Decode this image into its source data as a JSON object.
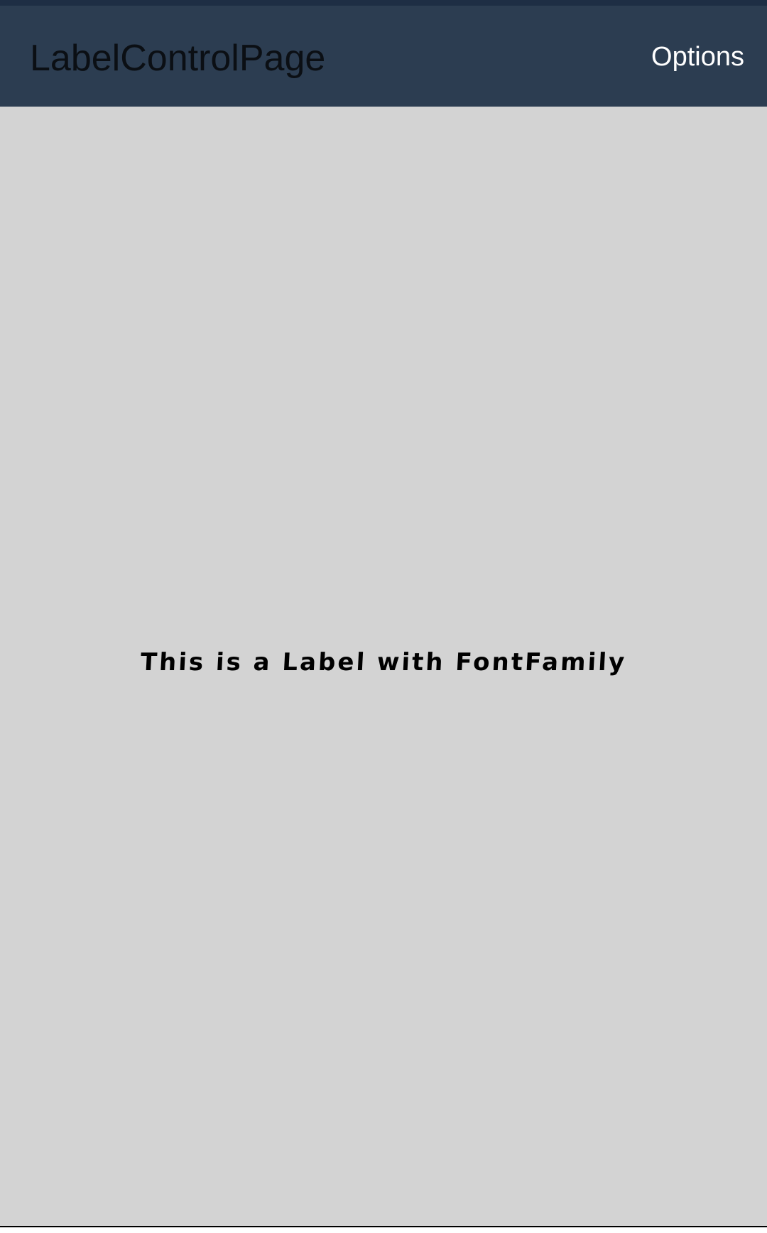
{
  "toolbar": {
    "title": "LabelControlPage",
    "options_label": "Options"
  },
  "content": {
    "label_text": "This is a Label with FontFamily"
  },
  "colors": {
    "toolbar_background": "#2c3d51",
    "page_background": "#d3d3d3",
    "title_text": "#0b0f14",
    "options_text": "#ffffff",
    "label_text": "#000000"
  }
}
